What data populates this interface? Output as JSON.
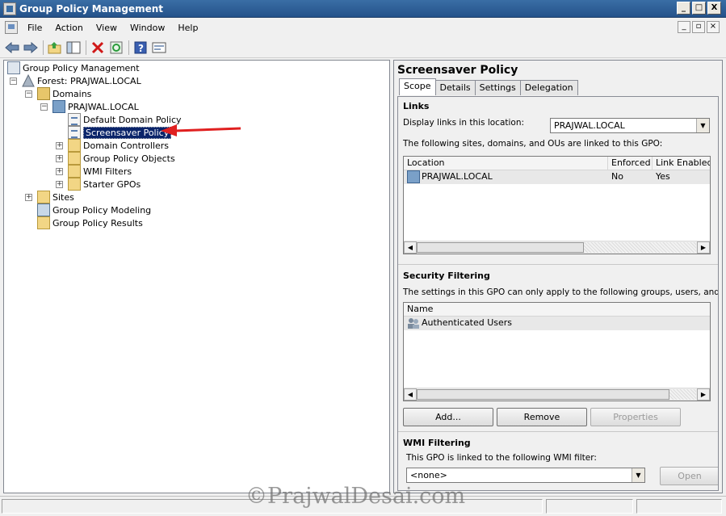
{
  "window": {
    "title": "Group Policy Management"
  },
  "window_buttons": {
    "minimize": "_",
    "maximize": "□",
    "close": "X"
  },
  "mdi_buttons": {
    "minimize": "_",
    "restore": "▫",
    "close": "×"
  },
  "menu": [
    "File",
    "Action",
    "View",
    "Window",
    "Help"
  ],
  "toolbar": [
    "back-icon",
    "forward-icon",
    "up-folder-icon",
    "show-hide-tree-icon",
    "delete-icon",
    "refresh-icon",
    "help-icon",
    "properties-icon"
  ],
  "tree": {
    "root": "Group Policy Management",
    "forest": "Forest: PRAJWAL.LOCAL",
    "domains": "Domains",
    "domain": "PRAJWAL.LOCAL",
    "default_policy": "Default Domain Policy",
    "screensaver_policy": "Screensaver Policy",
    "domain_controllers": "Domain Controllers",
    "gpo_objects": "Group Policy Objects",
    "wmi_filters": "WMI Filters",
    "starter_gpos": "Starter GPOs",
    "sites": "Sites",
    "modeling": "Group Policy Modeling",
    "results": "Group Policy Results",
    "expand_glyph": "+",
    "collapse_glyph": "−"
  },
  "details": {
    "title": "Screensaver Policy",
    "tabs": [
      "Scope",
      "Details",
      "Settings",
      "Delegation"
    ],
    "active_tab": "Scope",
    "links": {
      "title": "Links",
      "display_label": "Display links in this location:",
      "display_value": "PRAJWAL.LOCAL",
      "description": "The following sites, domains, and OUs are linked to this GPO:",
      "columns": [
        "Location",
        "Enforced",
        "Link Enabled"
      ],
      "rows": [
        {
          "location": "PRAJWAL.LOCAL",
          "enforced": "No",
          "link_enabled": "Yes"
        }
      ]
    },
    "security": {
      "title": "Security Filtering",
      "description": "The settings in this GPO can only apply to the following groups, users, and compu",
      "columns": [
        "Name"
      ],
      "rows": [
        "Authenticated Users"
      ],
      "buttons": {
        "add": "Add...",
        "remove": "Remove",
        "properties": "Properties"
      }
    },
    "wmi": {
      "title": "WMI Filtering",
      "description": "This GPO is linked to the following WMI filter:",
      "value": "<none>",
      "open_button": "Open"
    }
  },
  "scroll_glyphs": {
    "left": "◀",
    "right": "▶",
    "down": "▼"
  },
  "watermark": "©PrajwalDesai.com",
  "colors": {
    "selection": "#0a246a",
    "arrow": "#e02020",
    "title_bar": "#3a6ea5"
  }
}
